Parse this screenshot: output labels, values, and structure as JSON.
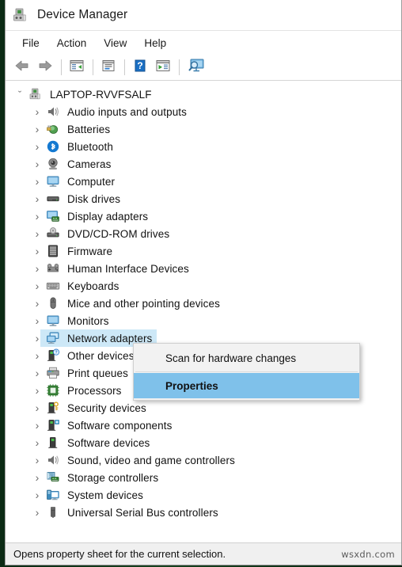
{
  "window": {
    "title": "Device Manager",
    "app_icon": "device-manager-icon"
  },
  "menubar": {
    "items": [
      {
        "label": "File",
        "name": "menu-file"
      },
      {
        "label": "Action",
        "name": "menu-action"
      },
      {
        "label": "View",
        "name": "menu-view"
      },
      {
        "label": "Help",
        "name": "menu-help"
      }
    ]
  },
  "toolbar": {
    "buttons": [
      {
        "icon": "back-arrow-icon",
        "name": "toolbar-back"
      },
      {
        "icon": "forward-arrow-icon",
        "name": "toolbar-forward"
      },
      {
        "icon": "show-hide-console-tree-icon",
        "name": "toolbar-console-tree"
      },
      {
        "icon": "properties-icon",
        "name": "toolbar-properties"
      },
      {
        "icon": "help-icon",
        "name": "toolbar-help"
      },
      {
        "icon": "update-driver-icon",
        "name": "toolbar-update-driver"
      },
      {
        "icon": "scan-hardware-changes-icon",
        "name": "toolbar-scan-hardware"
      }
    ]
  },
  "tree": {
    "root": {
      "label": "LAPTOP-RVVFSALF",
      "icon": "computer-root-icon",
      "expanded": true
    },
    "nodes": [
      {
        "label": "Audio inputs and outputs",
        "icon": "speaker-icon",
        "selected": false
      },
      {
        "label": "Batteries",
        "icon": "battery-icon",
        "selected": false
      },
      {
        "label": "Bluetooth",
        "icon": "bluetooth-icon",
        "selected": false
      },
      {
        "label": "Cameras",
        "icon": "camera-icon",
        "selected": false
      },
      {
        "label": "Computer",
        "icon": "monitor-icon",
        "selected": false
      },
      {
        "label": "Disk drives",
        "icon": "disk-drive-icon",
        "selected": false
      },
      {
        "label": "Display adapters",
        "icon": "display-adapter-icon",
        "selected": false
      },
      {
        "label": "DVD/CD-ROM drives",
        "icon": "optical-drive-icon",
        "selected": false
      },
      {
        "label": "Firmware",
        "icon": "firmware-chip-icon",
        "selected": false
      },
      {
        "label": "Human Interface Devices",
        "icon": "hid-icon",
        "selected": false
      },
      {
        "label": "Keyboards",
        "icon": "keyboard-icon",
        "selected": false
      },
      {
        "label": "Mice and other pointing devices",
        "icon": "mouse-icon",
        "selected": false
      },
      {
        "label": "Monitors",
        "icon": "monitor-icon",
        "selected": false
      },
      {
        "label": "Network adapters",
        "icon": "network-adapter-icon",
        "selected": true
      },
      {
        "label": "Other devices",
        "icon": "unknown-device-icon",
        "selected": false
      },
      {
        "label": "Print queues",
        "icon": "printer-icon",
        "selected": false
      },
      {
        "label": "Processors",
        "icon": "processor-icon",
        "selected": false
      },
      {
        "label": "Security devices",
        "icon": "security-device-icon",
        "selected": false
      },
      {
        "label": "Software components",
        "icon": "software-component-icon",
        "selected": false
      },
      {
        "label": "Software devices",
        "icon": "software-device-icon",
        "selected": false
      },
      {
        "label": "Sound, video and game controllers",
        "icon": "speaker-icon",
        "selected": false
      },
      {
        "label": "Storage controllers",
        "icon": "storage-controller-icon",
        "selected": false
      },
      {
        "label": "System devices",
        "icon": "system-device-icon",
        "selected": false
      },
      {
        "label": "Universal Serial Bus controllers",
        "icon": "usb-icon",
        "selected": false
      }
    ],
    "collapsed_glyph": "›",
    "expanded_glyph": "ˇ"
  },
  "context_menu": {
    "items": [
      {
        "label": "Scan for hardware changes",
        "highlighted": false,
        "name": "ctx-scan-hardware-changes"
      },
      {
        "label": "Properties",
        "highlighted": true,
        "name": "ctx-properties"
      }
    ]
  },
  "statusbar": {
    "text": "Opens property sheet for the current selection.",
    "watermark": "wsxdn.com"
  },
  "colors": {
    "selection_blue": "#cde8f7",
    "menu_highlight_blue": "#7fc1ea",
    "window_bg": "#ffffff",
    "statusbar_bg": "#f0f0f0",
    "desktop_green": "#17421f"
  }
}
